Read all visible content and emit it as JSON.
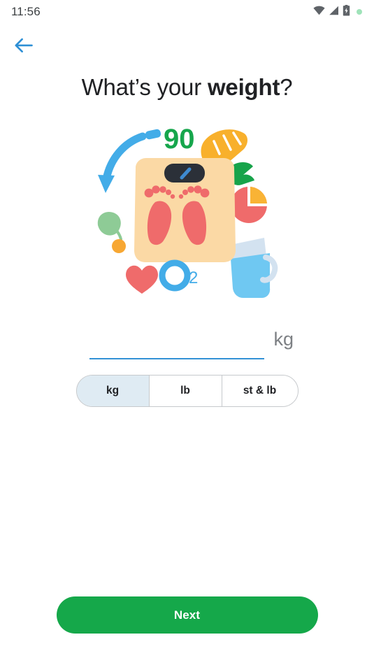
{
  "status_bar": {
    "time": "11:56",
    "icons": [
      {
        "name": "wifi-icon",
        "label": "wifi"
      },
      {
        "name": "cellular-signal-icon",
        "label": "signal"
      },
      {
        "name": "battery-charging-icon",
        "label": "battery"
      },
      {
        "name": "recording-indicator-dot",
        "label": "indicator",
        "color": "#9fe3b9"
      }
    ]
  },
  "nav": {
    "back_label": "Back"
  },
  "header": {
    "title_prefix": "What’s your ",
    "title_emphasis": "weight",
    "title_suffix": "?"
  },
  "illustration": {
    "name": "weight-scale-illustration",
    "scale_reading": "90",
    "o2_label": "O",
    "o2_sub": "2",
    "elements": [
      "bathroom-scale",
      "footprints",
      "scale-display",
      "blue-curved-arrow",
      "number-90",
      "carrot",
      "pie-chart",
      "water-glass",
      "oxygen-symbol",
      "heart",
      "leaf",
      "orange-dot"
    ],
    "colors": {
      "scale_body": "#fbd9a5",
      "scale_display": "#2b3038",
      "footprint": "#ef6b6b",
      "arrow_blue": "#43ace8",
      "green": "#16a64c",
      "carrot_orange": "#f8b02c",
      "pie_red": "#ef6b6b",
      "pie_orange": "#f9b335",
      "water_light": "#6fc8f2",
      "water_pale": "#d3e2f0",
      "heart": "#ef6b6b",
      "leaf": "#8ecb96",
      "dot_orange": "#f7a733"
    }
  },
  "weight_input": {
    "value": "",
    "placeholder": "",
    "unit_label": "kg"
  },
  "unit_selector": {
    "selected": "kg",
    "options": [
      {
        "label": "kg",
        "selected": true
      },
      {
        "label": "lb",
        "selected": false
      },
      {
        "label": "st & lb",
        "selected": false
      }
    ]
  },
  "footer": {
    "next_label": "Next",
    "next_color": "#15a84a"
  }
}
